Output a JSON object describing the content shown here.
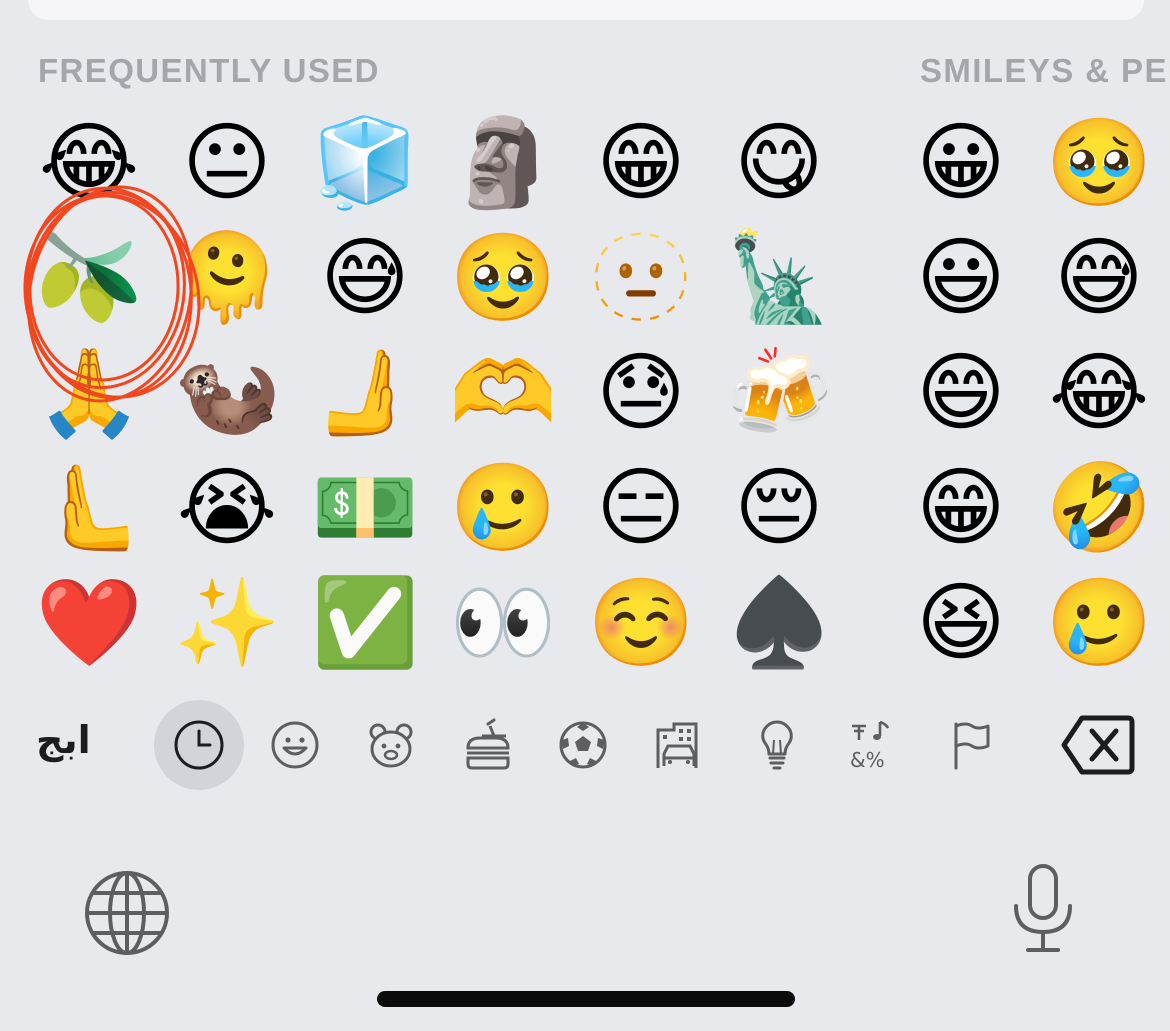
{
  "sections": {
    "frequent_title": "FREQUENTLY USED",
    "smileys_title": "SMILEYS & PE"
  },
  "frequent_emojis": [
    "😂",
    "😐",
    "🧊",
    "🗿",
    "😁",
    "😋",
    "🫒",
    "🫠",
    "😅",
    "🥹",
    "🫥",
    "🗽",
    "🙏",
    "🦦",
    "🫸",
    "🫶",
    "😓",
    "🍻",
    "🫷",
    "😭",
    "💵",
    "🥲",
    "😑",
    "😔",
    "❤️",
    "✨",
    "✅",
    "👀",
    "☺️",
    "♠️"
  ],
  "smileys_emojis": [
    "😀",
    "🥹",
    "😃",
    "😅",
    "😄",
    "😂",
    "😁",
    "🤣",
    "😆",
    "🥲"
  ],
  "annotation": {
    "color": "#f2461f",
    "target": "olive"
  },
  "category_bar": {
    "abc_label": "ابج",
    "selected": "recent",
    "icons": [
      "clock-icon",
      "smiley-icon",
      "animal-icon",
      "food-icon",
      "soccer-ball-icon",
      "buildings-icon",
      "lightbulb-icon",
      "symbols-icon",
      "flag-icon",
      "delete-icon"
    ]
  },
  "bottom_bar": {
    "icons": [
      "globe-icon",
      "microphone-icon"
    ]
  },
  "colors": {
    "background": "#e8e9ed",
    "selected_key": "#d2d4da",
    "section_title": "#a4a6ab",
    "icon_stroke": "#5e5e62"
  }
}
